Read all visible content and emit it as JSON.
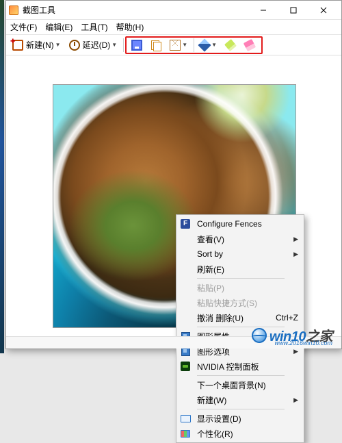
{
  "window": {
    "title": "截图工具"
  },
  "menu": {
    "file": "文件(F)",
    "edit": "编辑(E)",
    "tools": "工具(T)",
    "help": "帮助(H)"
  },
  "toolbar": {
    "new_label": "新建(N)",
    "delay_label": "延迟(D)",
    "icons": {
      "save": "save-icon",
      "copy": "copy-icon",
      "mail": "mail-icon",
      "pen": "pen-icon",
      "high": "highlighter-icon",
      "eraser": "eraser-icon"
    }
  },
  "context_menu": {
    "items": [
      {
        "icon": "F",
        "label": "Configure Fences"
      },
      {
        "label": "查看(V)",
        "submenu": true
      },
      {
        "label": "Sort by",
        "submenu": true
      },
      {
        "label": "刷新(E)"
      },
      {
        "sep": true
      },
      {
        "label": "粘贴(P)",
        "disabled": true
      },
      {
        "label": "粘贴快捷方式(S)",
        "disabled": true
      },
      {
        "label": "撤消 删除(U)",
        "shortcut": "Ctrl+Z"
      },
      {
        "sep": true
      },
      {
        "icon": "gfx",
        "label": "图形属性......"
      },
      {
        "icon": "gfx",
        "label": "图形选项",
        "submenu": true
      },
      {
        "icon": "nv",
        "label": "NVIDIA 控制面板"
      },
      {
        "sep": true
      },
      {
        "label": "下一个桌面背景(N)"
      },
      {
        "label": "新建(W)",
        "submenu": true
      },
      {
        "sep": true
      },
      {
        "icon": "disp",
        "label": "显示设置(D)"
      },
      {
        "icon": "pers",
        "label": "个性化(R)"
      }
    ]
  },
  "watermark": {
    "brand1": "win10",
    "brand2": "之家",
    "url": "www.2016win10.com"
  }
}
